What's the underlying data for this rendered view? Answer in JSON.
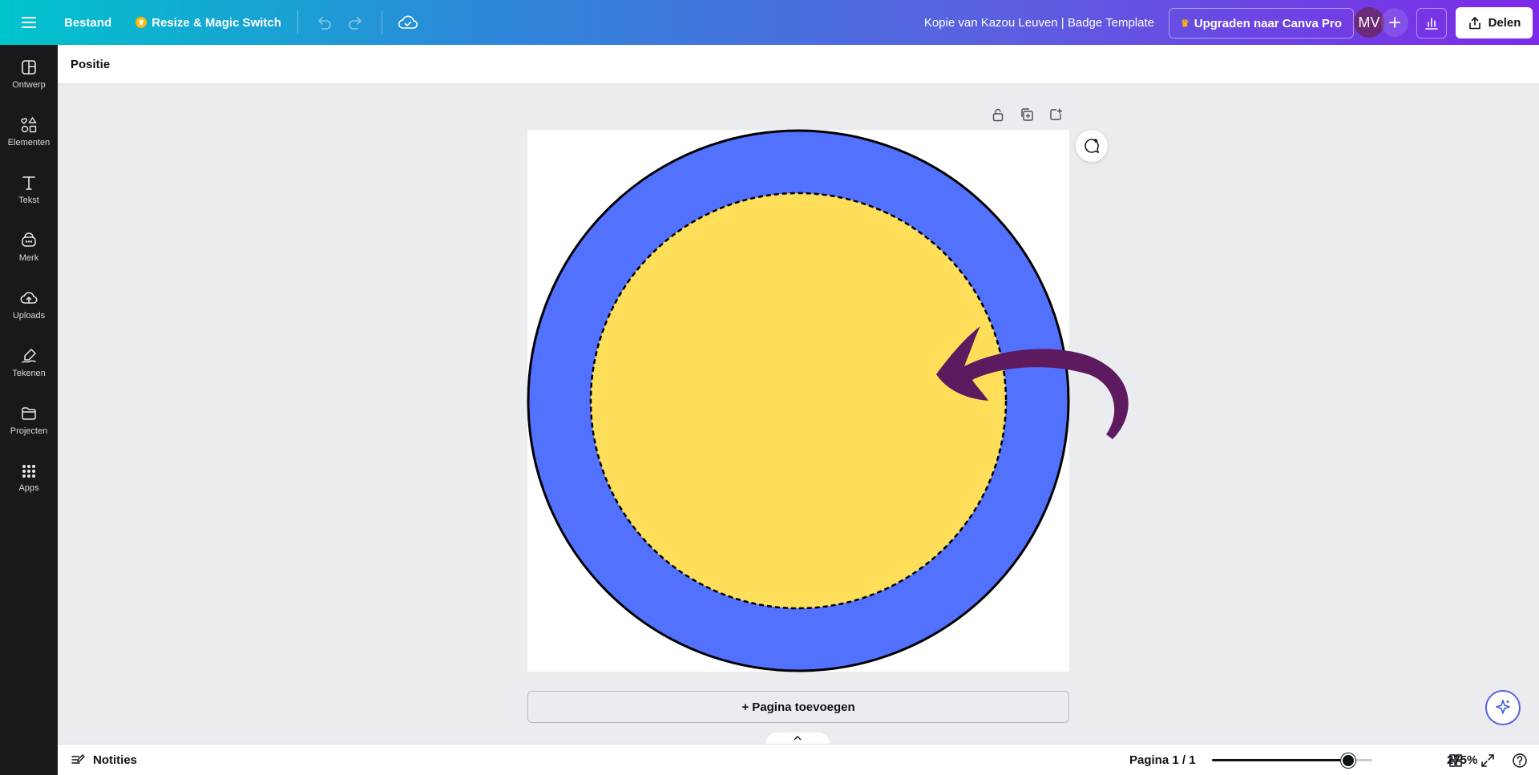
{
  "topbar": {
    "file_label": "Bestand",
    "resize_label": "Resize & Magic Switch",
    "document_title": "Kopie van Kazou Leuven | Badge Template",
    "upgrade_label": "Upgraden naar Canva Pro",
    "avatar_initials": "MV",
    "share_label": "Delen"
  },
  "sidebar": {
    "items": [
      {
        "label": "Ontwerp",
        "icon": "layout-icon"
      },
      {
        "label": "Elementen",
        "icon": "shapes-icon"
      },
      {
        "label": "Tekst",
        "icon": "text-icon"
      },
      {
        "label": "Merk",
        "icon": "brand-icon"
      },
      {
        "label": "Uploads",
        "icon": "upload-icon"
      },
      {
        "label": "Tekenen",
        "icon": "draw-icon"
      },
      {
        "label": "Projecten",
        "icon": "folder-icon"
      },
      {
        "label": "Apps",
        "icon": "apps-icon"
      }
    ]
  },
  "context": {
    "position_label": "Positie"
  },
  "canvas": {
    "add_page_label": "+ Pagina toevoegen",
    "colors": {
      "outer_circle": "#5271ff",
      "inner_circle": "#ffde59",
      "arrow": "#5e1a5e"
    }
  },
  "bottombar": {
    "notes_label": "Notities",
    "page_indicator": "Pagina 1 / 1",
    "zoom_label": "275%",
    "zoom_fraction": 0.85
  }
}
